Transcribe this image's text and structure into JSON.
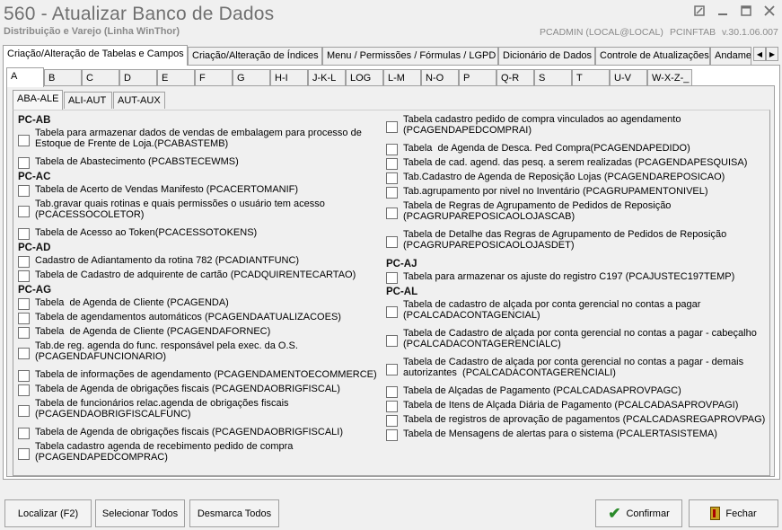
{
  "window": {
    "title": "560 - Atualizar Banco de Dados",
    "subtitle": "Distribuição e Varejo (Linha WinThor)",
    "user_info": "PCADMIN (LOCAL@LOCAL)",
    "db_info": "PCINFTAB",
    "version": "v.30.1.06.007"
  },
  "main_tabs": [
    "Criação/Alteração de Tabelas e Campos",
    "Criação/Alteração de Índices",
    "Menu / Permissões / Fórmulas / LGPD",
    "Dicionário de Dados",
    "Controle de Atualizações",
    "Andame"
  ],
  "letter_tabs": [
    "A",
    "B",
    "C",
    "D",
    "E",
    "F",
    "G",
    "H-I",
    "J-K-L",
    "LOG",
    "L-M",
    "N-O",
    "P",
    "Q-R",
    "S",
    "T",
    "U-V",
    "W-X-Z-_"
  ],
  "sub_tabs": [
    "ABA-ALE",
    "ALI-AUT",
    "AUT-AUX"
  ],
  "left_column": [
    {
      "group": "PC-AB",
      "items": [
        "Tabela para armazenar dados de vendas de embalagem para processo de\nEstoque de Frente de Loja.(PCABASTEMB)",
        "Tabela de Abastecimento (PCABSTECEWMS)"
      ]
    },
    {
      "group": "PC-AC",
      "items": [
        "Tabela de Acerto de Vendas Manifesto (PCACERTOMANIF)",
        "Tab.gravar quais rotinas e quais permissões o usuário tem acesso\n(PCACESSOCOLETOR)",
        "Tabela de Acesso ao Token(PCACESSOTOKENS)"
      ]
    },
    {
      "group": "PC-AD",
      "items": [
        "Cadastro de Adiantamento da rotina 782 (PCADIANTFUNC)",
        "Tabela de Cadastro de adquirente de cartão (PCADQUIRENTECARTAO)"
      ]
    },
    {
      "group": "PC-AG",
      "items": [
        "Tabela  de Agenda de Cliente (PCAGENDA)",
        "Tabela de agendamentos automáticos (PCAGENDAATUALIZACOES)",
        "Tabela  de Agenda de Cliente (PCAGENDAFORNEC)",
        "Tab.de reg. agenda do func. responsável pela exec. da O.S.\n(PCAGENDAFUNCIONARIO)",
        "Tabela de informações de agendamento (PCAGENDAMENTOECOMMERCE)",
        "Tabela de Agenda de obrigações fiscais (PCAGENDAOBRIGFISCAL)",
        "Tabela de funcionários relac.agenda de obrigações fiscais\n(PCAGENDAOBRIGFISCALFUNC)",
        "Tabela de Agenda de obrigações fiscais (PCAGENDAOBRIGFISCALI)",
        "Tabela cadastro agenda de recebimento pedido de compra\n(PCAGENDAPEDCOMPRAC)"
      ]
    }
  ],
  "right_column": [
    {
      "group": "",
      "items": [
        "Tabela cadastro pedido de compra vinculados ao agendamento\n(PCAGENDAPEDCOMPRAI)",
        "Tabela  de Agenda de Desca. Ped Compra(PCAGENDAPEDIDO)",
        "Tabela de cad. agend. das pesq. a serem realizadas (PCAGENDAPESQUISA)",
        "Tab.Cadastro de Agenda de Reposição Lojas (PCAGENDAREPOSICAO)",
        "Tab.agrupamento por nivel no Inventário (PCAGRUPAMENTONIVEL)",
        "Tabela de Regras de Agrupamento de Pedidos de Reposição\n(PCAGRUPAREPOSICAOLOJASCAB)",
        "Tabela de Detalhe das Regras de Agrupamento de Pedidos de Reposição\n(PCAGRUPAREPOSICAOLOJASDET)"
      ]
    },
    {
      "group": "PC-AJ",
      "items": [
        "Tabela para armazenar os ajuste do registro C197 (PCAJUSTEC197TEMP)"
      ]
    },
    {
      "group": "PC-AL",
      "items": [
        "Tabela de cadastro de alçada por conta gerencial no contas a pagar\n(PCALCADACONTAGENCIAL)",
        "Tabela de Cadastro de alçada por conta gerencial no contas a pagar - cabeçalho\n(PCALCADACONTAGERENCIALC)",
        "Tabela de Cadastro de alçada por conta gerencial no contas a pagar - demais\nautorizantes  (PCALCADACONTAGERENCIALI)",
        "Tabela de Alçadas de Pagamento (PCALCADASAPROVPAGC)",
        "Tabela de Itens de Alçada Diária de Pagamento (PCALCADASAPROVPAGI)",
        "Tabela de registros de aprovação de pagamentos (PCALCADASREGAPROVPAG)",
        "Tabela de Mensagens de alertas para o sistema (PCALERTASISTEMA)"
      ]
    }
  ],
  "buttons": {
    "localizar": "Localizar (F2)",
    "selecionar": "Selecionar Todos",
    "desmarca": "Desmarca Todos",
    "confirmar": "Confirmar",
    "fechar": "Fechar"
  }
}
